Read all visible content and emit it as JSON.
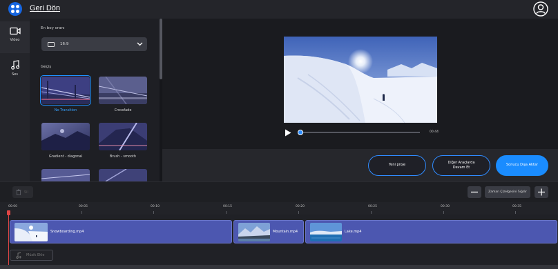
{
  "header": {
    "back_label": "Geri Dön",
    "logo_icon": "logo-icon",
    "account_icon": "account-icon"
  },
  "rail": {
    "items": [
      {
        "label": "Video",
        "icon": "video-camera-icon"
      },
      {
        "label": "Ses",
        "icon": "music-note-icon"
      }
    ]
  },
  "panel": {
    "aspect_label": "En boy oranı",
    "aspect_value": "16:9",
    "transition_label": "Geçiş",
    "transitions": [
      {
        "label": "No Transition",
        "selected": true
      },
      {
        "label": "Crossfade"
      },
      {
        "label": "Gradient - diagonal"
      },
      {
        "label": "Brush - smooth"
      }
    ]
  },
  "preview": {
    "time": "00:44",
    "progress": 0
  },
  "actions": {
    "new_project": "Yeni proje",
    "other_tools_line1": "Diğer Araçlarda",
    "other_tools_line2": "Devam Et",
    "export": "Sonucu Dışa Aktar"
  },
  "timeline": {
    "trash_label": "Sil",
    "zoom_fit_label": "Zaman Çizelgesini Sığdır",
    "ruler": [
      "00:00",
      "00:05",
      "00:10",
      "00:15",
      "00:20",
      "00:25",
      "00:30",
      "00:35"
    ],
    "clips": [
      {
        "name": "Snowboarding.mp4"
      },
      {
        "name": "Mountain.mp4"
      },
      {
        "name": "Lake.mp4"
      }
    ],
    "add_music_label": "Müzik Ekle"
  },
  "colors": {
    "accent": "#1a8cff",
    "clip": "#4c57b0",
    "playhead": "#e04545"
  }
}
